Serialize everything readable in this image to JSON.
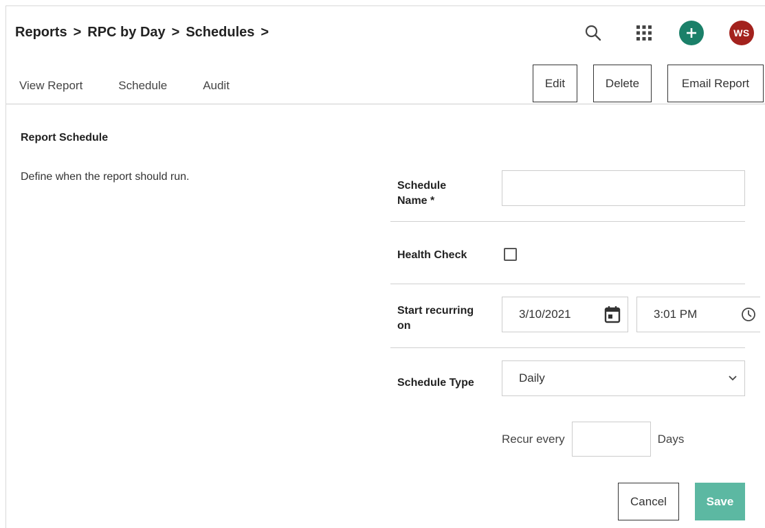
{
  "breadcrumb": {
    "items": [
      "Reports",
      "RPC by Day",
      "Schedules"
    ],
    "separator": ">"
  },
  "header_icons": {
    "search": "search-icon",
    "apps": "apps-grid-icon",
    "add": "plus-icon",
    "avatar_initials": "WS",
    "add_color": "#1b8069",
    "avatar_color": "#a3221d"
  },
  "tabs": [
    {
      "label": "View Report"
    },
    {
      "label": "Schedule"
    },
    {
      "label": "Audit"
    }
  ],
  "actions": {
    "edit_label": "Edit",
    "delete_label": "Delete",
    "email_label": "Email Report"
  },
  "section": {
    "title": "Report Schedule",
    "description": "Define when the report should run."
  },
  "form": {
    "schedule_name": {
      "label_line1": "Schedule",
      "label_line2": "Name *",
      "value": ""
    },
    "health_check": {
      "label": "Health Check",
      "checked": false
    },
    "start": {
      "label_line1": "Start recurring",
      "label_line2": "on",
      "date": "3/10/2021",
      "time": "3:01 PM"
    },
    "schedule_type": {
      "label": "Schedule Type",
      "selected": "Daily"
    },
    "recur": {
      "prefix": "Recur every",
      "value": "",
      "suffix": "Days"
    }
  },
  "footer": {
    "cancel_label": "Cancel",
    "save_label": "Save",
    "save_color": "#5cb8a2"
  }
}
